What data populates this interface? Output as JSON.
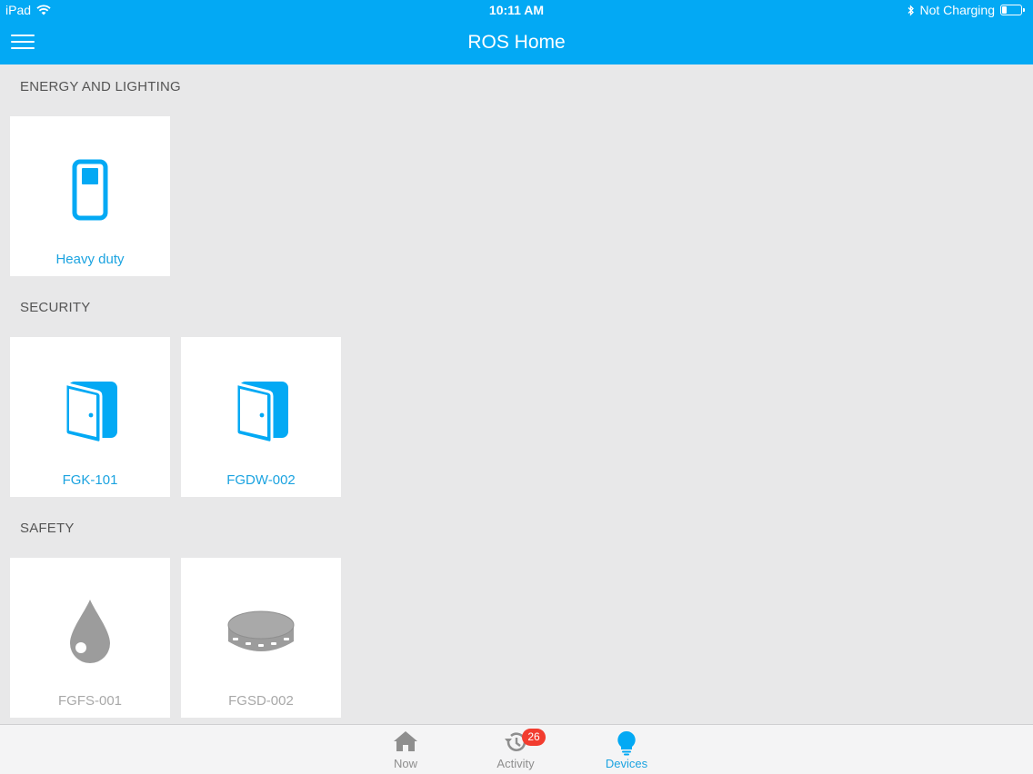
{
  "status_bar": {
    "device": "iPad",
    "time": "10:11 AM",
    "charging": "Not Charging",
    "battery_percent": 25
  },
  "header": {
    "title": "ROS Home"
  },
  "sections": [
    {
      "title": "ENERGY AND LIGHTING",
      "devices": [
        {
          "label": "Heavy duty",
          "icon": "switch-icon",
          "state": "active"
        }
      ]
    },
    {
      "title": "SECURITY",
      "devices": [
        {
          "label": "FGK-101",
          "icon": "door-sensor-icon",
          "state": "active"
        },
        {
          "label": "FGDW-002",
          "icon": "door-sensor-icon",
          "state": "active"
        }
      ]
    },
    {
      "title": "SAFETY",
      "devices": [
        {
          "label": "FGFS-001",
          "icon": "flood-sensor-icon",
          "state": "inactive"
        },
        {
          "label": "FGSD-002",
          "icon": "smoke-detector-icon",
          "state": "inactive"
        }
      ]
    }
  ],
  "tabs": [
    {
      "label": "Now",
      "icon": "house-icon"
    },
    {
      "label": "Activity",
      "icon": "history-icon",
      "badge": "26"
    },
    {
      "label": "Devices",
      "icon": "lightbulb-icon",
      "selected": true
    }
  ],
  "colors": {
    "accent": "#03a9f4",
    "label_active": "#1ba3e0",
    "label_inactive": "#a8a8a8",
    "badge": "#f23c2f",
    "background": "#e8e8e9"
  }
}
